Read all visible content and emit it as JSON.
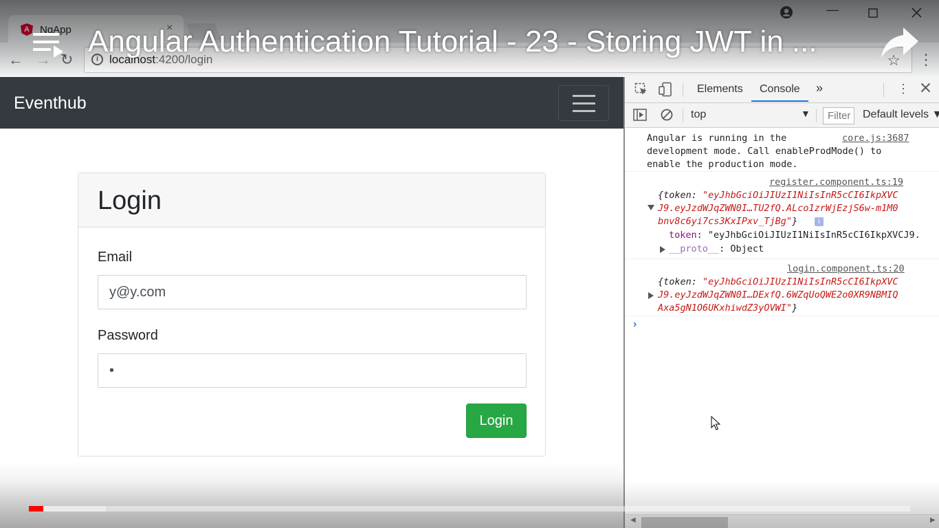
{
  "browser": {
    "tab_title": "NgApp",
    "tab_close": "×",
    "url_host": "localhost",
    "url_path": ":4200/login",
    "info_icon": "i"
  },
  "video": {
    "title": "Angular Authentication Tutorial - 23 - Storing JWT in ...",
    "progress_played": 0.016,
    "progress_buffered": 0.087,
    "accent": "#ff0000"
  },
  "app": {
    "brand": "Eventhub",
    "card_title": "Login",
    "email_label": "Email",
    "email_value": "y@y.com",
    "password_label": "Password",
    "password_value": "•",
    "login_button": "Login",
    "accent": "#28a745",
    "navbar_color": "#343a40"
  },
  "devtools": {
    "tabs": [
      "Elements",
      "Console"
    ],
    "more_tabs": "»",
    "context": "top",
    "filter_placeholder": "Filter",
    "levels": "Default levels",
    "messages": [
      {
        "source": "core.js:3687",
        "lines": [
          "Angular is running in the",
          "development mode. Call enableProdMode() to",
          "enable the production mode."
        ]
      },
      {
        "source": "register.component.ts:19",
        "lines": [
          "{token: \"eyJhbGciOiJIUzI1NiIsInR5cCI6IkpXVC",
          "J9.eyJzdWJqZWN0I…TU2fQ.ALco1zrWjEzjS6w-m1M0",
          "bnv8c6yi7cs3KxIPxv_TjBg\"}"
        ],
        "expanded_key": "token",
        "expanded_value": "\"eyJhbGciOiJIUzI1NiIsInR5cCI6IkpXVCJ9.",
        "proto_key": "__proto__",
        "proto_value": ": Object"
      },
      {
        "source": "login.component.ts:20",
        "lines": [
          "{token: \"eyJhbGciOiJIUzI1NiIsInR5cCI6IkpXVC",
          "J9.eyJzdWJqZWN0I…DExfQ.6WZqUoQWE2o0XR9NBMIQ",
          "Axa5gN1O6UKxhiwdZ3yOVWI\"}"
        ]
      }
    ],
    "prompt": "›"
  }
}
